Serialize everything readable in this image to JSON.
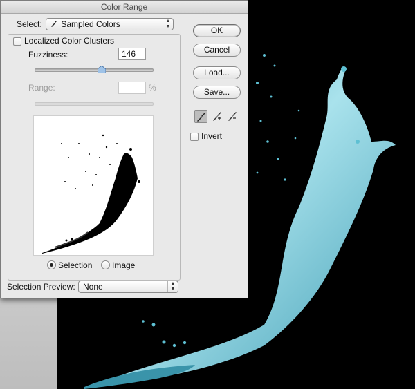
{
  "dialog": {
    "title": "Color Range",
    "select_label": "Select:",
    "select_value": "Sampled Colors",
    "localized_label": "Localized Color Clusters",
    "localized_checked": false,
    "fuzziness_label": "Fuzziness:",
    "fuzziness_value": "146",
    "fuzziness_fraction": 0.57,
    "range_label": "Range:",
    "range_value": "",
    "range_unit": "%",
    "range_enabled": false,
    "radio_selection_label": "Selection",
    "radio_image_label": "Image",
    "radio_selected": "selection",
    "preview_mode_label": "Selection Preview:",
    "preview_mode_value": "None",
    "buttons": {
      "ok": "OK",
      "cancel": "Cancel",
      "load": "Load...",
      "save": "Save..."
    },
    "invert_label": "Invert",
    "invert_checked": false,
    "eyedroppers": [
      "eyedropper-icon",
      "eyedropper-plus-icon",
      "eyedropper-minus-icon"
    ],
    "active_eyedropper": 0
  },
  "colors": {
    "dialog_bg": "#e9e9e9",
    "splash": "#6fc6d6",
    "canvas_bg": "#000000"
  }
}
